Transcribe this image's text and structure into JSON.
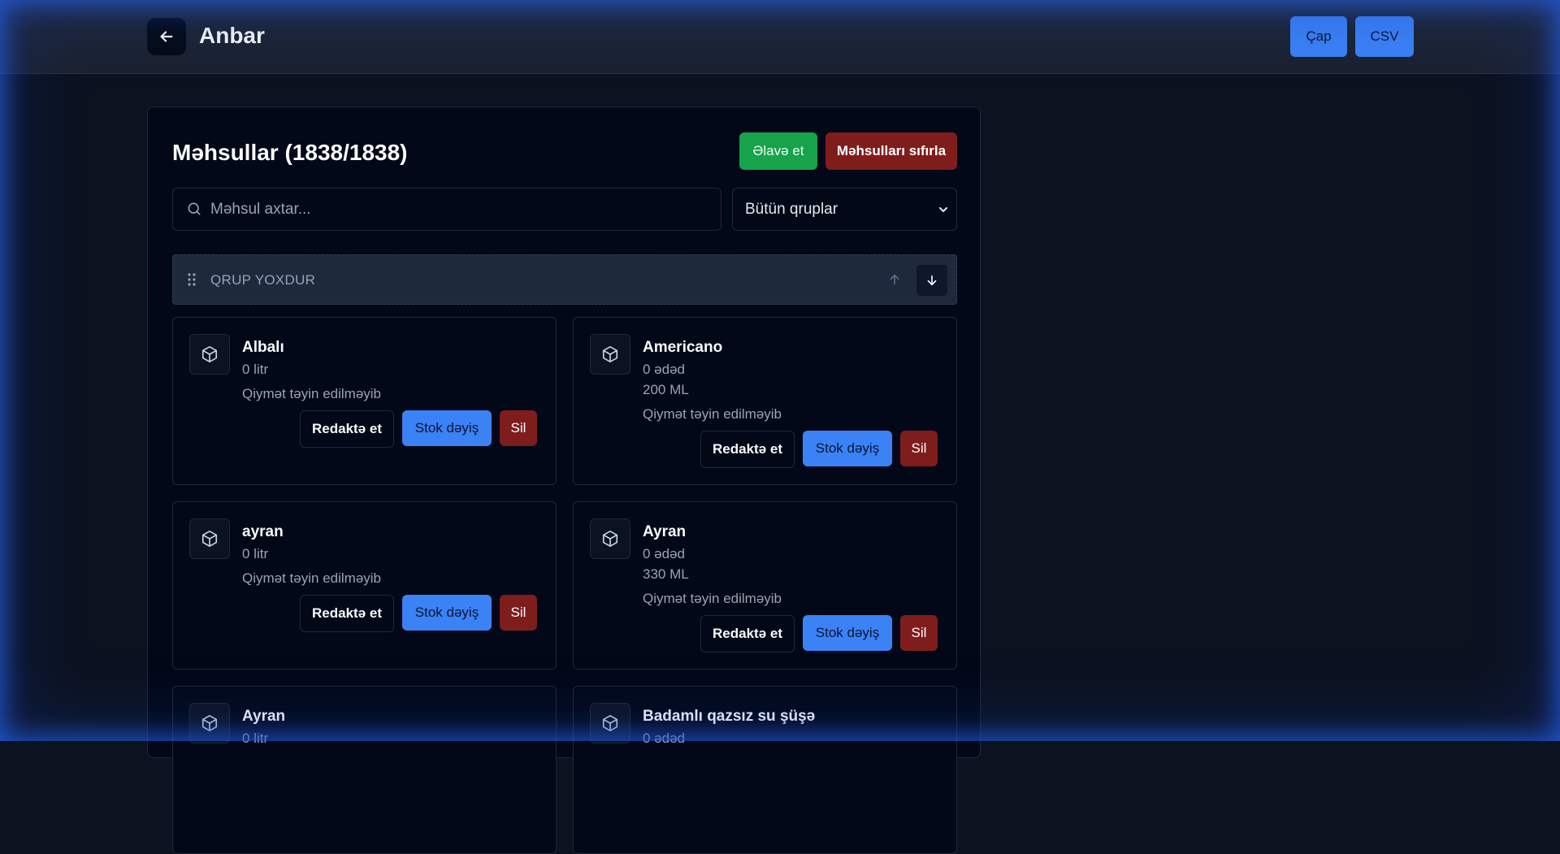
{
  "header": {
    "title": "Anbar",
    "print_label": "Çap",
    "csv_label": "CSV"
  },
  "products_panel": {
    "title": "Məhsullar (1838/1838)",
    "add_label": "Əlavə et",
    "reset_label": "Məhsulları sıfırla",
    "search_placeholder": "Məhsul axtar...",
    "group_filter_value": "Bütün qruplar",
    "group": {
      "name": "QRUP YOXDUR"
    },
    "actions": {
      "edit": "Redaktə et",
      "stock": "Stok dəyiş",
      "delete": "Sil"
    },
    "products": [
      {
        "name": "Albalı",
        "qty": "0 litr",
        "volume": "",
        "price": "Qiymət təyin edilməyib"
      },
      {
        "name": "Americano",
        "qty": "0 ədəd",
        "volume": "200 ML",
        "price": "Qiymət təyin edilməyib"
      },
      {
        "name": "ayran",
        "qty": "0 litr",
        "volume": "",
        "price": "Qiymət təyin edilməyib"
      },
      {
        "name": "Ayran",
        "qty": "0 ədəd",
        "volume": "330 ML",
        "price": "Qiymət təyin edilməyib"
      },
      {
        "name": "Ayran",
        "qty": "0 litr",
        "volume": "",
        "price": ""
      },
      {
        "name": "Badamlı qazsız su şüşə",
        "qty": "0 ədəd",
        "volume": "",
        "price": ""
      }
    ]
  },
  "icons": {
    "back": "arrow-left-icon",
    "search": "search-icon",
    "drag": "drag-handle-icon",
    "product": "package-icon"
  }
}
